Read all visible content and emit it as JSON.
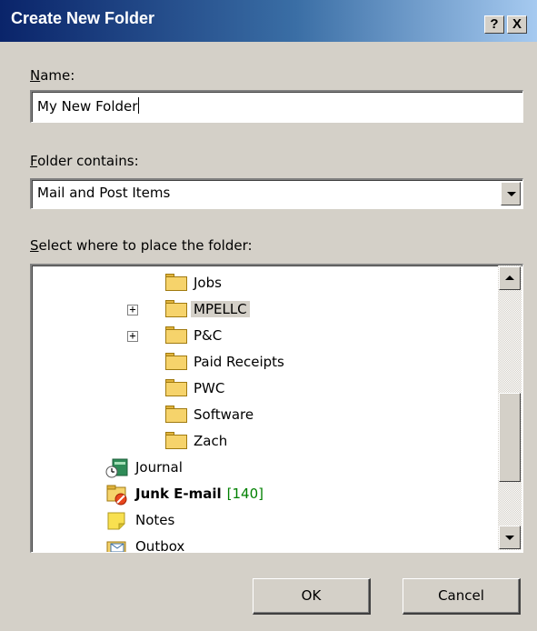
{
  "dialog": {
    "title": "Create New Folder",
    "help_label": "?",
    "close_label": "X"
  },
  "name_field": {
    "label_mnemonic": "N",
    "label_rest": "ame:",
    "value": "My New Folder"
  },
  "folder_contains": {
    "label_mnemonic": "F",
    "label_rest": "older contains:",
    "selected": "Mail and Post Items"
  },
  "location": {
    "label_mnemonic": "S",
    "label_rest": "elect where to place the folder:",
    "items": [
      {
        "label": "Jobs",
        "icon": "folder-icon",
        "expandable": false,
        "selected": false
      },
      {
        "label": "MPELLC",
        "icon": "folder-icon",
        "expandable": true,
        "selected": true
      },
      {
        "label": "P&C",
        "icon": "folder-icon",
        "expandable": true,
        "selected": false
      },
      {
        "label": "Paid Receipts",
        "icon": "folder-icon",
        "expandable": false,
        "selected": false
      },
      {
        "label": "PWC",
        "icon": "folder-icon",
        "expandable": false,
        "selected": false
      },
      {
        "label": "Software",
        "icon": "folder-icon",
        "expandable": false,
        "selected": false
      },
      {
        "label": "Zach",
        "icon": "folder-icon",
        "expandable": false,
        "selected": false
      },
      {
        "label": "Journal",
        "icon": "journal-icon",
        "expandable": false,
        "selected": false
      },
      {
        "label": "Junk E-mail",
        "count": "[140]",
        "icon": "junk-mail-icon",
        "expandable": false,
        "selected": false,
        "bold": true
      },
      {
        "label": "Notes",
        "icon": "notes-icon",
        "expandable": false,
        "selected": false
      },
      {
        "label": "Outbox",
        "icon": "outbox-icon",
        "expandable": false,
        "selected": false
      }
    ],
    "expander_symbol": "+"
  },
  "buttons": {
    "ok": "OK",
    "cancel": "Cancel"
  },
  "colors": {
    "titlebar_start": "#0a246a",
    "dialog_face": "#d4d0c8",
    "unread_count": "#008000"
  }
}
